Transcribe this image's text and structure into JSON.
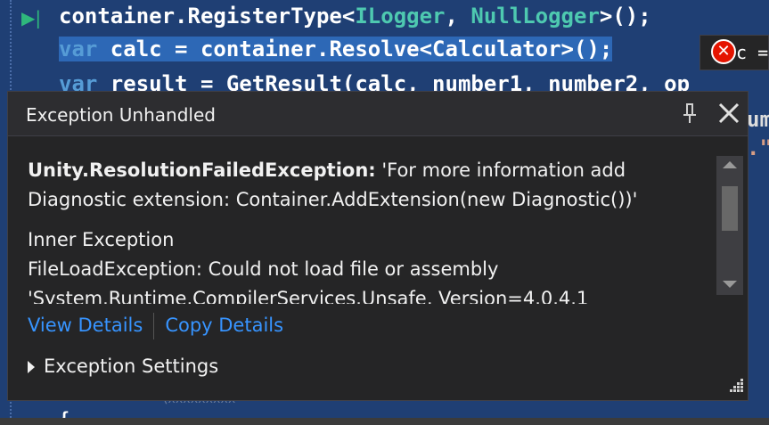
{
  "editor": {
    "line1": {
      "receiver": "container.RegisterType<",
      "type1": "ILogger",
      "sep": ", ",
      "type2": "NullLogger",
      "rest": ">();"
    },
    "line2": {
      "kw": "var",
      "rest": " calc = container.Resolve<Calculator>();"
    },
    "line3": {
      "kw": "var",
      "rest": " result = GetResult(calc, number1, number2, op"
    },
    "right_fragment_1": "um",
    "right_fragment_2": ".\"",
    "bottom_fragment": "\\xxxxxxxxx",
    "bottom_brace": "{",
    "tooltip_text": "c ="
  },
  "popup": {
    "title": "Exception Unhandled",
    "exception_type": "Unity.ResolutionFailedException:",
    "exception_message": " 'For more information add Diagnostic extension: Container.AddExtension(new Diagnostic())'",
    "inner_heading": "Inner Exception",
    "inner_message": "FileLoadException: Could not load file or assembly",
    "inner_message_cont": "'System.Runtime.CompilerServices.Unsafe, Version=4.0.4.1",
    "view_details": "View Details",
    "copy_details": "Copy Details",
    "settings_label": "Exception Settings"
  },
  "icons": {
    "pin": "pin-icon",
    "close": "close-icon",
    "error": "error-icon",
    "expand": "expand-triangle-icon",
    "grip": "resize-grip-icon",
    "debug_arrow": "execution-arrow-icon"
  },
  "colors": {
    "editor_bg": "#1f3f74",
    "selection": "#2d68b6",
    "popup_bg": "#252526",
    "link": "#3794ff",
    "error": "#e51400"
  }
}
